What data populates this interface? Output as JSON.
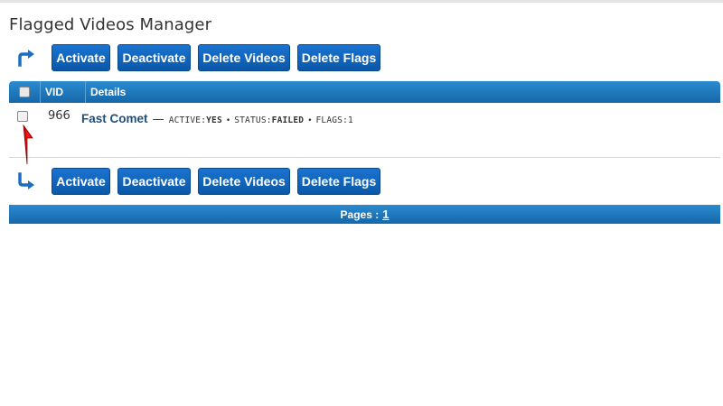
{
  "page": {
    "title": "Flagged Videos Manager"
  },
  "actions": {
    "activate": "Activate",
    "deactivate": "Deactivate",
    "delete_videos": "Delete Videos",
    "delete_flags": "Delete Flags"
  },
  "table": {
    "columns": {
      "vid": "VID",
      "details": "Details"
    },
    "rows": [
      {
        "vid": "966",
        "title": "Fast Comet",
        "dash": "—",
        "active_label": "ACTIVE:",
        "active_value": "YES",
        "status_label": "STATUS:",
        "status_value": "FAILED",
        "flags_label": "FLAGS:",
        "flags_value": "1",
        "separator": "•"
      }
    ]
  },
  "pagination": {
    "label": "Pages :",
    "current": "1"
  },
  "icons": {
    "top_arrow": "turn-up-right-arrow-icon",
    "bottom_arrow": "turn-down-right-arrow-icon",
    "annotation": "red-up-arrow-icon"
  },
  "colors": {
    "button_blue": "#0b5bb0",
    "header_blue": "#1a70b5",
    "title_link": "#1d4f7f",
    "annotation_red": "#e00000"
  }
}
